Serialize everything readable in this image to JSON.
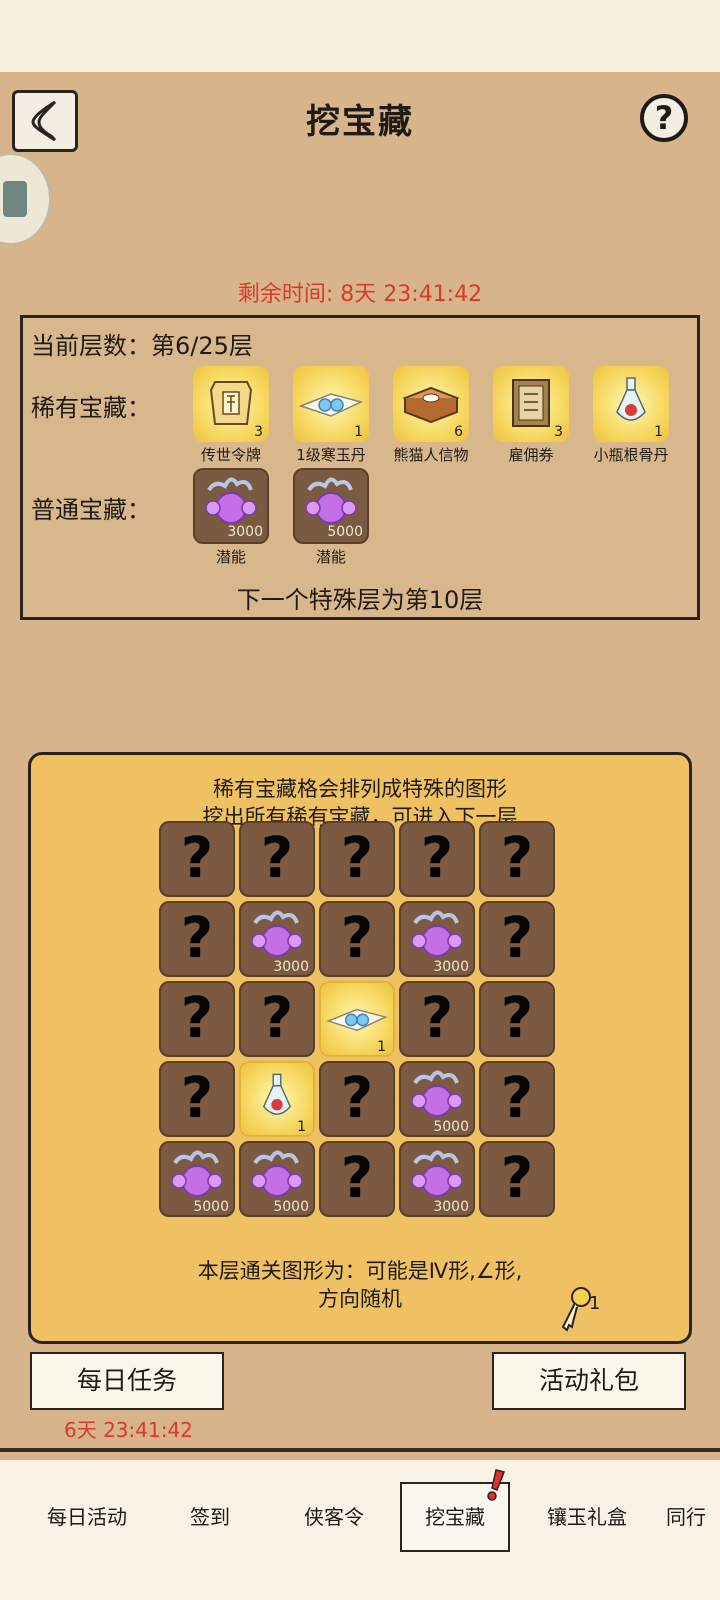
{
  "header": {
    "title": "挖宝藏",
    "help": "?"
  },
  "timer": "剩余时间: 8天 23:41:42",
  "info": {
    "floor_label": "当前层数：第6/25层",
    "rare_label": "稀有宝藏：",
    "common_label": "普通宝藏：",
    "rare_items": [
      {
        "name": "传世令牌",
        "count": "3",
        "icon": "token-plaque-icon"
      },
      {
        "name": "1级寒玉丹",
        "count": "1",
        "icon": "jade-pill-icon"
      },
      {
        "name": "熊猫人信物",
        "count": "6",
        "icon": "panda-token-icon"
      },
      {
        "name": "雇佣券",
        "count": "3",
        "icon": "hire-ticket-icon"
      },
      {
        "name": "小瓶根骨丹",
        "count": "1",
        "icon": "potion-bottle-icon"
      }
    ],
    "common_items": [
      {
        "name": "潜能",
        "count": "3000",
        "icon": "potential-orb-icon"
      },
      {
        "name": "潜能",
        "count": "5000",
        "icon": "potential-orb-icon"
      }
    ],
    "next_special": "下一个特殊层为第10层"
  },
  "board": {
    "hint_line1": "稀有宝藏格会排列成特殊的图形",
    "hint_line2": "挖出所有稀有宝藏，可进入下一层",
    "cells": [
      [
        "?",
        "?",
        "?",
        "?",
        "?"
      ],
      [
        "?",
        "潜能:3000",
        "?",
        "潜能:3000",
        "?"
      ],
      [
        "?",
        "?",
        "寒玉丹:1",
        "?",
        "?"
      ],
      [
        "?",
        "根骨丹:1",
        "?",
        "潜能:5000",
        "?"
      ],
      [
        "潜能:5000",
        "潜能:5000",
        "?",
        "潜能:3000",
        "?"
      ]
    ],
    "shape_line1": "本层通关图形为：可能是Ⅳ形,∠形,",
    "shape_line2": "方向随机",
    "key_count": "1"
  },
  "buttons": {
    "daily_tasks": "每日任务",
    "gift_pack": "活动礼包",
    "daily_timer": "6天 23:41:42"
  },
  "nav": [
    "每日活动",
    "签到",
    "侠客令",
    "挖宝藏",
    "镶玉礼盒",
    "同行"
  ],
  "colors": {
    "background": "#d7b48a",
    "panel": "#f0c163",
    "timer_red": "#d83a2c",
    "cell_brown": "#7c5a42"
  }
}
